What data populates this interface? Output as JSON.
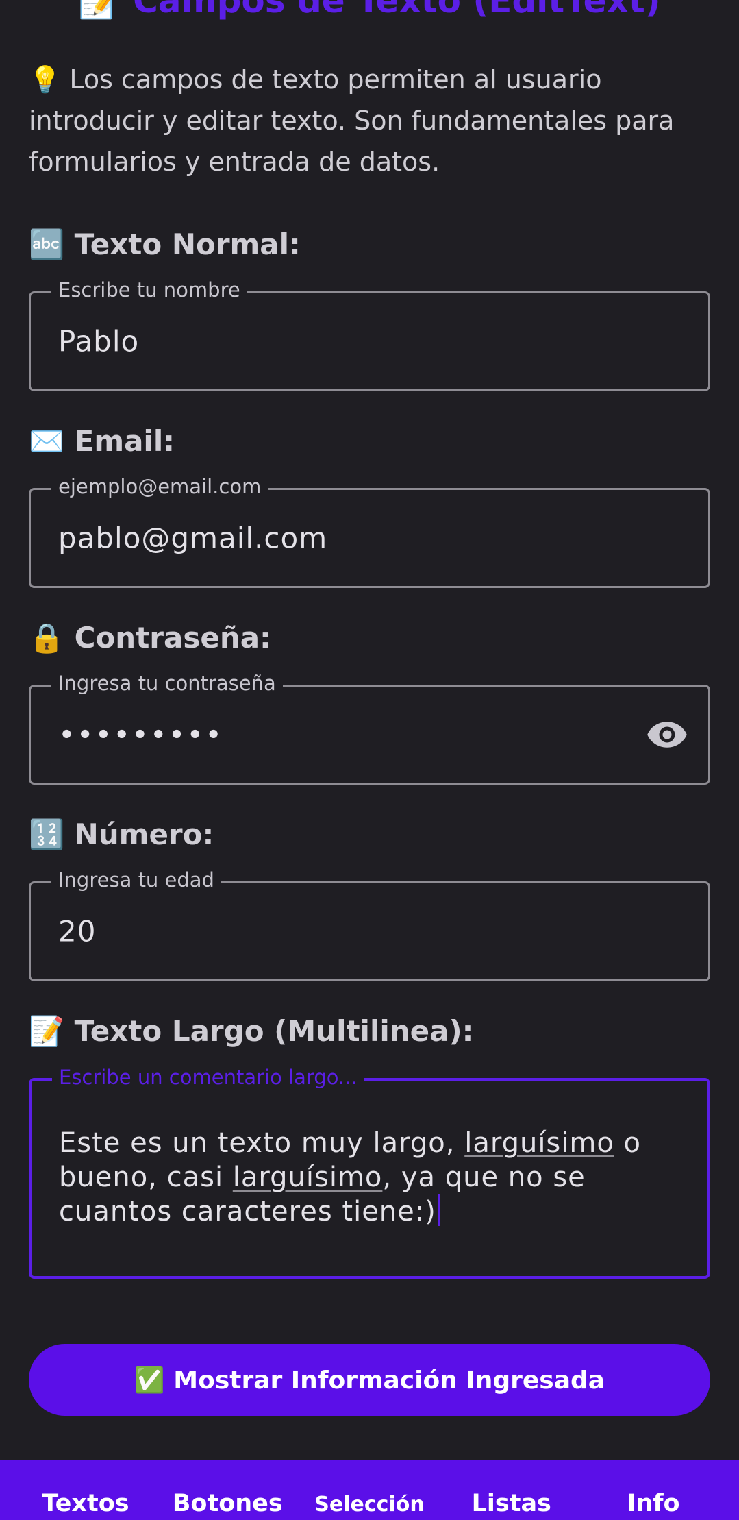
{
  "screen": {
    "title": "Campos de Texto (EditText)",
    "title_emoji": "📝",
    "description": "💡 Los campos de texto permiten al usuario introducir y editar texto. Son fundamentales para formularios y entrada de datos."
  },
  "fields": {
    "name": {
      "section_emoji": "🔤",
      "section_label": "Texto Normal:",
      "hint": "Escribe tu nombre",
      "value": "Pablo"
    },
    "email": {
      "section_emoji": "✉️",
      "section_label": "Email:",
      "hint": "ejemplo@email.com",
      "value": "pablo@gmail.com"
    },
    "password": {
      "section_emoji": "🔒",
      "section_label": "Contraseña:",
      "hint": "Ingresa tu contraseña",
      "value": "•••••••••",
      "toggle_icon": "eye-icon"
    },
    "number": {
      "section_emoji": "🔢",
      "section_label": "Número:",
      "hint": "Ingresa tu edad",
      "value": "20"
    },
    "multiline": {
      "section_emoji": "📝",
      "section_label": "Texto Largo (Multilinea):",
      "hint": "Escribe un comentario largo...",
      "value_part1": "Este es un texto muy largo, ",
      "spell1": "larguísimo",
      "value_part2": " o bueno, casi ",
      "spell2": "larguísimo",
      "value_part3": ", ya que no se cuantos caracteres tiene:)"
    }
  },
  "submit_button": {
    "label": "✅ Mostrar Información Ingresada"
  },
  "bottom_nav": {
    "items": [
      {
        "label": "Textos"
      },
      {
        "label": "Botones"
      },
      {
        "label": "Selección"
      },
      {
        "label": "Listas"
      },
      {
        "label": "Info"
      }
    ]
  },
  "colors": {
    "background": "#1f1e23",
    "accent": "#5b1fe6",
    "nav_background": "#5b0fe8",
    "outline": "#8e8c93"
  }
}
